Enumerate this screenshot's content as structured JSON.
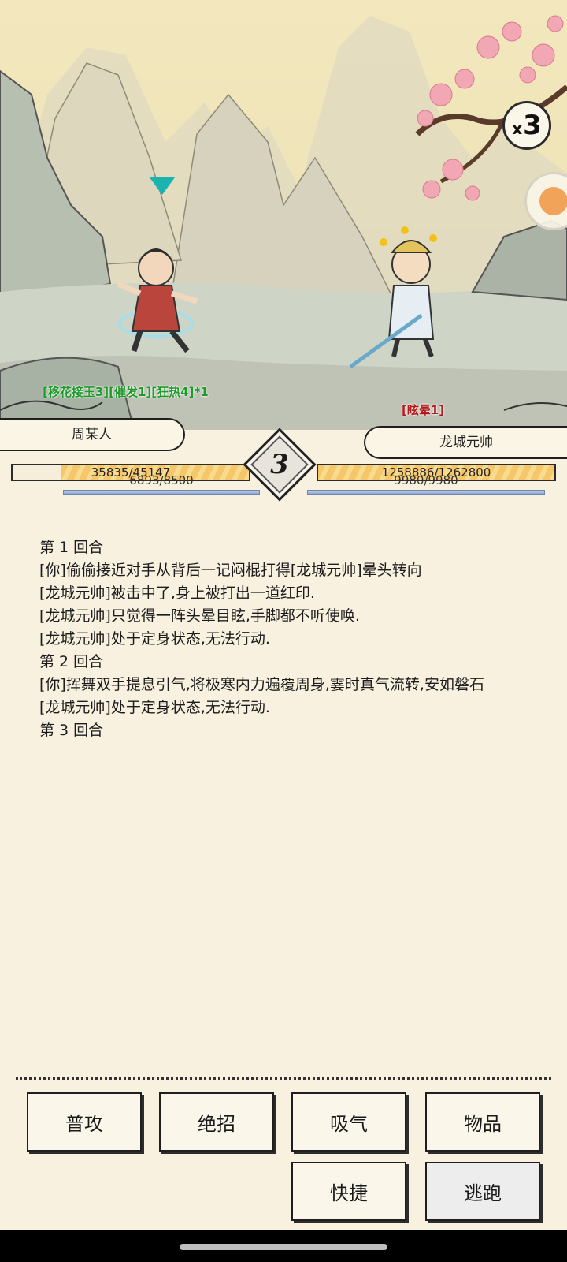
{
  "scene": {
    "speed": {
      "prefix": "x",
      "value": "3"
    },
    "player_status": "[移花接玉3][催发1][狂热4]*1",
    "enemy_status": "[眩晕1]"
  },
  "player": {
    "name": "周某人",
    "hp_text": "35835/45147",
    "hp_fraction": 0.794,
    "mp_text": "6893/8500"
  },
  "enemy": {
    "name": "龙城元帅",
    "hp_text": "1258886/1262800",
    "hp_fraction": 0.997,
    "mp_text": "9980/9980"
  },
  "round": "3",
  "log": [
    "第 1 回合",
    "[你]偷偷接近对手从背后一记闷棍打得[龙城元帅]晕头转向",
    "[龙城元帅]被击中了,身上被打出一道红印.",
    "[龙城元帅]只觉得一阵头晕目眩,手脚都不听使唤.",
    "[龙城元帅]处于定身状态,无法行动.",
    "第 2 回合",
    "[你]挥舞双手提息引气,将极寒内力遍覆周身,霎时真气流转,安如磐石",
    "[龙城元帅]处于定身状态,无法行动.",
    "第 3 回合"
  ],
  "actions": {
    "attack": "普攻",
    "ultimate": "绝招",
    "absorb": "吸气",
    "items": "物品",
    "quick": "快捷",
    "flee": "逃跑"
  },
  "colors": {
    "background": "#f8f1e0",
    "status_green": "#1f9a2a",
    "status_red": "#b3191a",
    "hp_fill": "#f5c66a",
    "mp_fill": "#8aa6d2"
  }
}
